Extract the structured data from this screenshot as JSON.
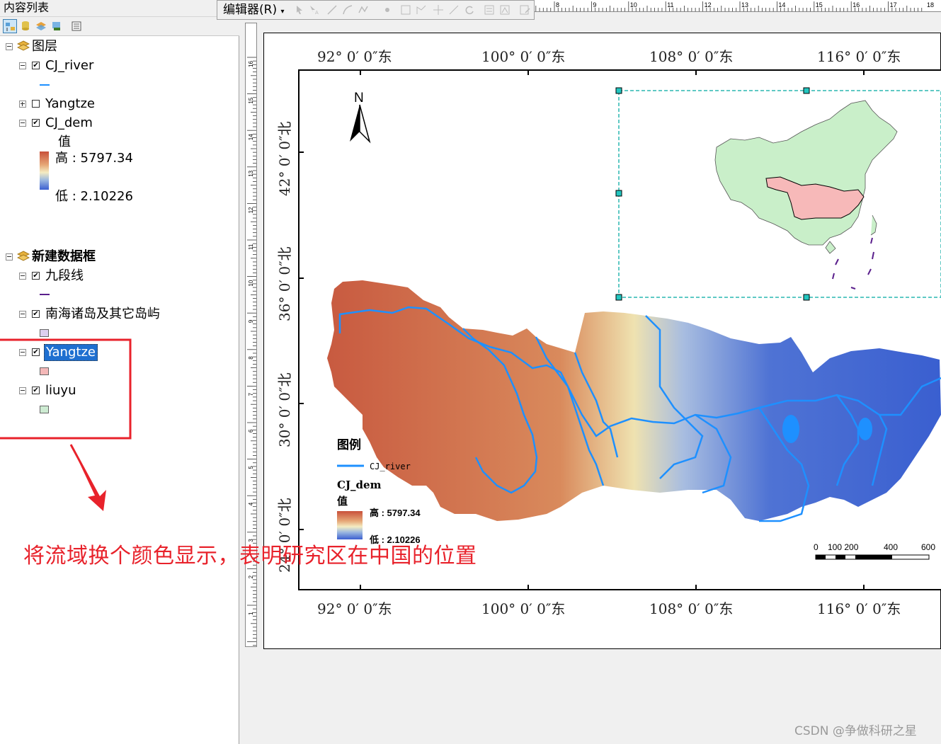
{
  "toc": {
    "title": "内容列表",
    "frames": [
      {
        "name": "图层",
        "layers": [
          {
            "name": "CJ_river",
            "checked": true,
            "symbol": "line",
            "color": "#1e90ff"
          },
          {
            "name": "Yangtze",
            "checked": false,
            "collapsed": true
          },
          {
            "name": "CJ_dem",
            "checked": true,
            "field": "值",
            "high": "高 : 5797.34",
            "low": "低 : 2.10226"
          }
        ]
      },
      {
        "name": "新建数据框",
        "layers": [
          {
            "name": "九段线",
            "checked": true,
            "symbol": "line",
            "color": "#5a1f8c"
          },
          {
            "name": "南海诸岛及其它岛屿",
            "checked": true,
            "symbol": "fill",
            "color": "#ddd0f0"
          },
          {
            "name": "Yangtze",
            "checked": true,
            "symbol": "fill",
            "color": "#f4b8b8",
            "selected": true
          },
          {
            "name": "liuyu",
            "checked": true,
            "symbol": "fill",
            "color": "#cdebd2"
          }
        ]
      }
    ]
  },
  "editor_toolbar": {
    "menu_label": "编辑器(R)"
  },
  "ruler_top_labels": [
    "8",
    "9",
    "10",
    "11",
    "12",
    "13",
    "14",
    "15",
    "16",
    "17",
    "18"
  ],
  "ruler_left_labels": [
    "16",
    "15",
    "14",
    "13",
    "12",
    "11",
    "10",
    "9",
    "8",
    "7",
    "6",
    "5",
    "4",
    "3",
    "2",
    "1"
  ],
  "map": {
    "lon_labels": [
      "92°  0′ 0″东",
      "100°  0′ 0″东",
      "108°  0′ 0″东",
      "116°  0′ 0″东"
    ],
    "lat_labels": [
      "42°  0′ 0″北",
      "36°  0′ 0″北",
      "30°  0′ 0″北",
      "24°  0′ 0″北"
    ],
    "north_arrow": "N",
    "legend": {
      "title": "图例",
      "river": "CJ_river",
      "dem_title": "CJ_dem",
      "field": "值",
      "high": "高 : 5797.34",
      "low": "低 : 2.10226"
    },
    "scale_labels": [
      "0",
      "100 200",
      "400",
      "600"
    ],
    "colors": {
      "river": "#1e90ff",
      "china": "#c9efc9",
      "yangtze": "#f7b9b9",
      "frame": "#2ab7b0"
    }
  },
  "annotation": "将流域换个颜色显示，表明研究区在中国的位置",
  "watermark": "CSDN @争做科研之星"
}
